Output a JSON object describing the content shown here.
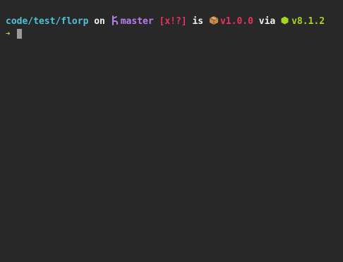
{
  "prompt": {
    "path": "code/test/florp",
    "on_word": "on",
    "branch_icon": "git-branch-icon",
    "branch": "master",
    "git_status": "[x!?]",
    "is_word": "is",
    "package_icon": "package-box-icon",
    "package_version": "v1.0.0",
    "via_word": "via",
    "node_icon": "nodejs-hexagon-icon",
    "node_version": "v8.1.2",
    "arrow": "➔"
  },
  "colors": {
    "background": "#282828",
    "path": "#4fc1d8",
    "git": "#b57ff0",
    "status": "#e8335e",
    "node": "#a3d81d",
    "arrow": "#d8d838",
    "cursor": "#9a9a9a"
  }
}
